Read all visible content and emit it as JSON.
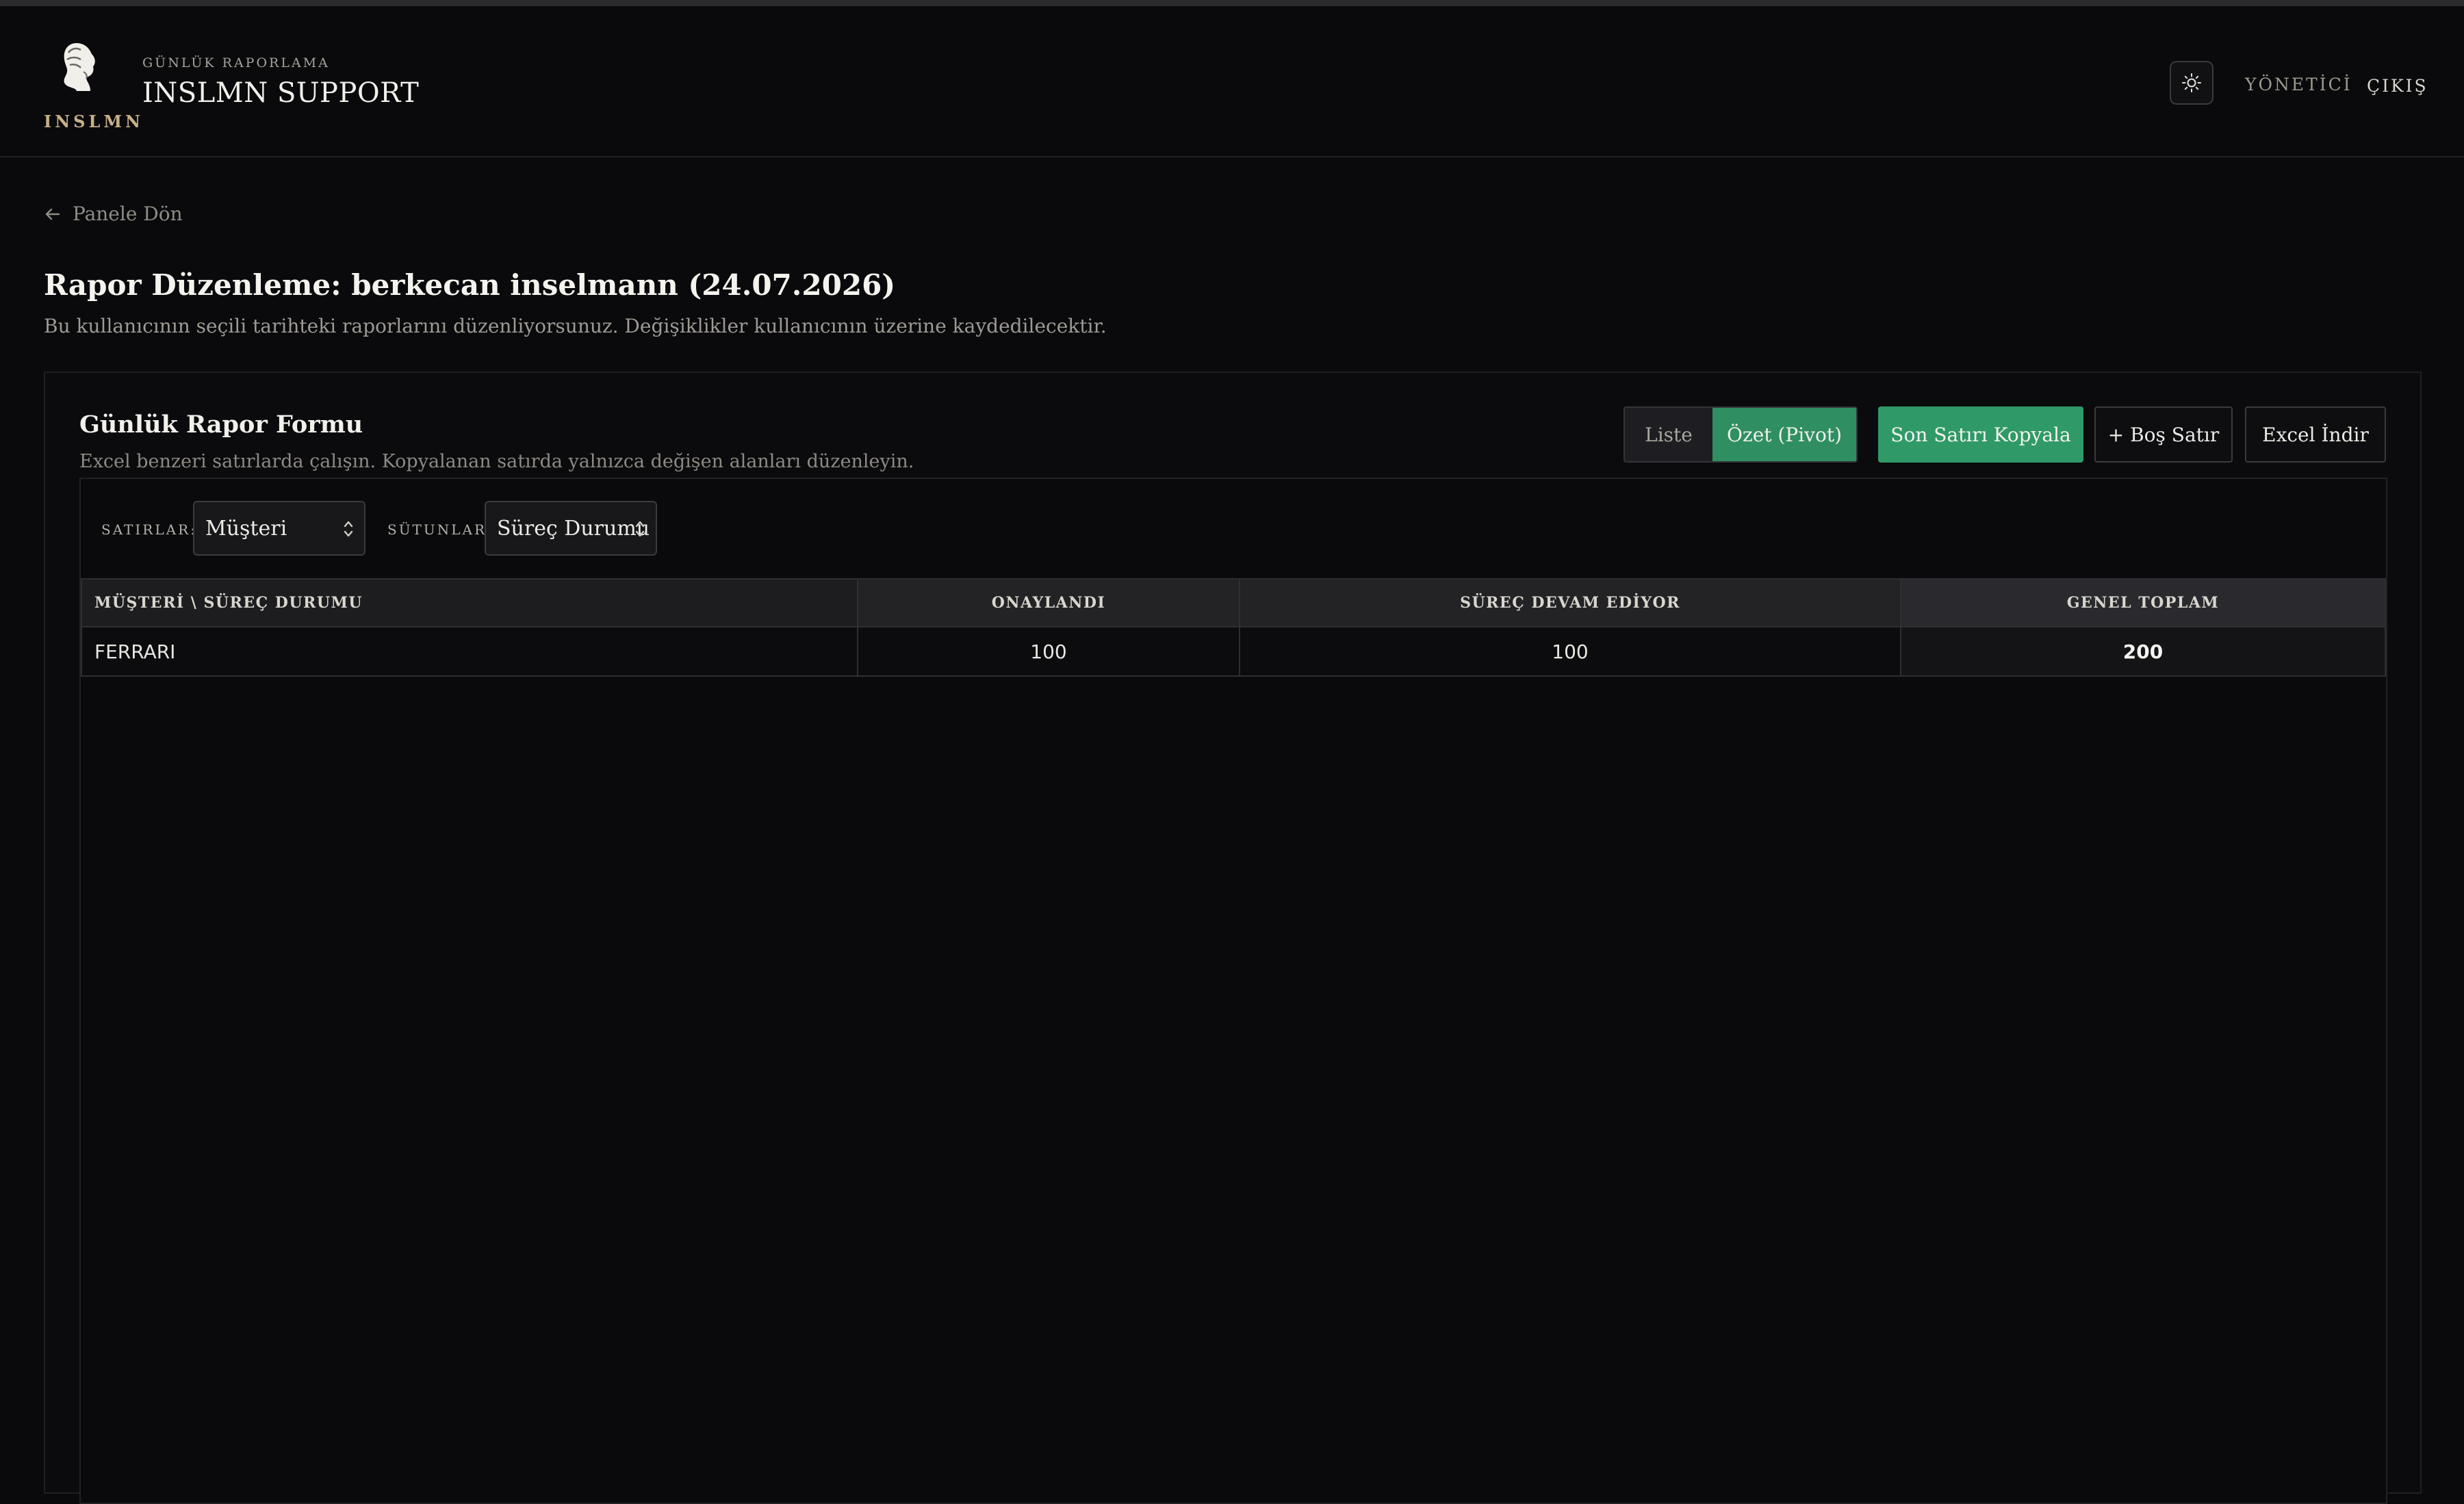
{
  "header": {
    "logo_text": "INSLMN",
    "subtitle": "GÜNLÜK RAPORLAMA",
    "title": "INSLMN SUPPORT",
    "nav_admin": "YÖNETİCİ",
    "nav_exit": "ÇIKIŞ",
    "theme_icon": "sun-icon"
  },
  "back": {
    "label": "Panele Dön"
  },
  "page": {
    "title": "Rapor Düzenleme: berkecan inselmann (24.07.2026)",
    "description": "Bu kullanıcının seçili tarihteki raporlarını düzenliyorsunuz. Değişiklikler kullanıcının üzerine kaydedilecektir."
  },
  "form": {
    "title": "Günlük Rapor Formu",
    "description": "Excel benzeri satırlarda çalışın. Kopyalanan satırda yalnızca değişen alanları düzenleyin.",
    "view_list": "Liste",
    "view_pivot": "Özet (Pivot)",
    "copy_last_row": "Son Satırı Kopyala",
    "add_empty_row": "+ Boş Satır",
    "excel_download": "Excel İndir",
    "accent_color": "#2f9a68"
  },
  "pivot": {
    "rows_label": "SATIRLAR:",
    "rows_value": "Müşteri",
    "cols_label": "SÜTUNLAR:",
    "cols_value": "Süreç Durumu",
    "corner_header": "MÜŞTERİ \\ SÜREÇ DURUMU",
    "columns": [
      "ONAYLANDI",
      "SÜREÇ DEVAM EDİYOR",
      "GENEL TOPLAM"
    ],
    "rows": [
      {
        "label": "FERRARI",
        "values": [
          "100",
          "100",
          "200"
        ]
      }
    ]
  }
}
